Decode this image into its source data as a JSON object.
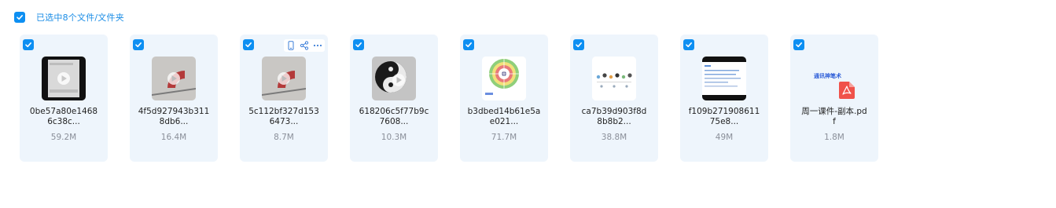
{
  "header": {
    "selected_label": "已选中8个文件/文件夹"
  },
  "files": [
    {
      "name_line1": "0be57a80e1468",
      "name_line2": "6c38c...",
      "size": "59.2M",
      "thumb_icon": "video-thumbnail-dark"
    },
    {
      "name_line1": "4f5d927943b311",
      "name_line2": "8db6...",
      "size": "16.4M",
      "thumb_icon": "video-thumbnail-gauge"
    },
    {
      "name_line1": "5c112bf327d153",
      "name_line2": "6473...",
      "size": "8.7M",
      "thumb_icon": "video-thumbnail-gauge"
    },
    {
      "name_line1": "618206c5f77b9c",
      "name_line2": "7608...",
      "size": "10.3M",
      "thumb_icon": "video-thumbnail-yinyang"
    },
    {
      "name_line1": "b3dbed14b61e5a",
      "name_line2": "e021...",
      "size": "71.7M",
      "thumb_icon": "image-thumbnail-wheel"
    },
    {
      "name_line1": "ca7b39d903f8d",
      "name_line2": "8b8b2...",
      "size": "38.8M",
      "thumb_icon": "image-thumbnail-dots"
    },
    {
      "name_line1": "f109b271908611",
      "name_line2": "75e8...",
      "size": "49M",
      "thumb_icon": "image-thumbnail-document"
    },
    {
      "name_line1": "周一课件-副本.pd",
      "name_line2": "f",
      "size": "1.8M",
      "thumb_icon": "pdf-file-icon",
      "thumb_caption": "通讯神笔术"
    }
  ],
  "colors": {
    "accent": "#0d8ff2",
    "card_bg": "#eef5fc",
    "pdf_red": "#f0524a"
  }
}
